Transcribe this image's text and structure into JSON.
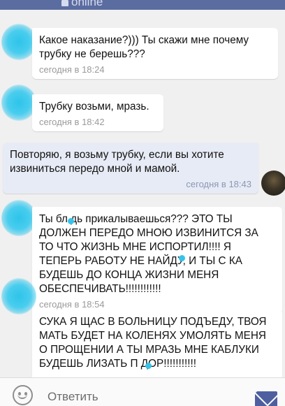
{
  "header": {
    "status": "online"
  },
  "messages": [
    {
      "direction": "in",
      "text": "Какое наказание?))) Ты скажи мне почему трубку не берешь???",
      "time": "сегодня в 18:24"
    },
    {
      "direction": "in",
      "text": "Трубку возьми, мразь.",
      "time": "сегодня в 18:42"
    },
    {
      "direction": "out",
      "text": "Повторяю, я возьму трубку, если вы хотите извиниться передо мной и мамой.",
      "time": "сегодня в 18:43"
    },
    {
      "direction": "in",
      "text": "Ты бл дь прикалываешься??? ЭТО ТЫ ДОЛЖЕН ПЕРЕДО МНОЮ ИЗВИНИТСЯ ЗА ТО ЧТО ЖИЗНЬ МНЕ ИСПОРТИЛ!!!! Я ТЕПЕРЬ РАБОТУ НЕ НАЙДУ, И ТЫ С КА БУДЕШЬ ДО КОНЦА ЖИЗНИ МЕНЯ ОБЕСПЕЧИВАТЬ!!!!!!!!!!!!",
      "time": "сегодня в 18:54"
    },
    {
      "direction": "in",
      "text": "СУКА Я ЩАС В БОЛЬНИЦУ ПОДЪЕДУ, ТВОЯ МАТЬ БУДЕТ НА КОЛЕНЯХ УМОЛЯТЬ МЕНЯ О ПРОЩЕНИИ А ТЫ МРАЗЬ МНЕ КАБЛУКИ БУДЕШЬ ЛИЗАТЬ П ДОР!!!!!!!!!!!",
      "time": ""
    }
  ],
  "composer": {
    "placeholder": "Ответить",
    "emoji_icon": "smiley-icon",
    "send_icon": "envelope-icon"
  },
  "colors": {
    "header": "#5b6ca0",
    "outgoing_bubble": "#e7ebf5",
    "incoming_bubble": "#ffffff",
    "avatar_redaction": "#36c3ea",
    "send_icon": "#4e5fa0"
  }
}
